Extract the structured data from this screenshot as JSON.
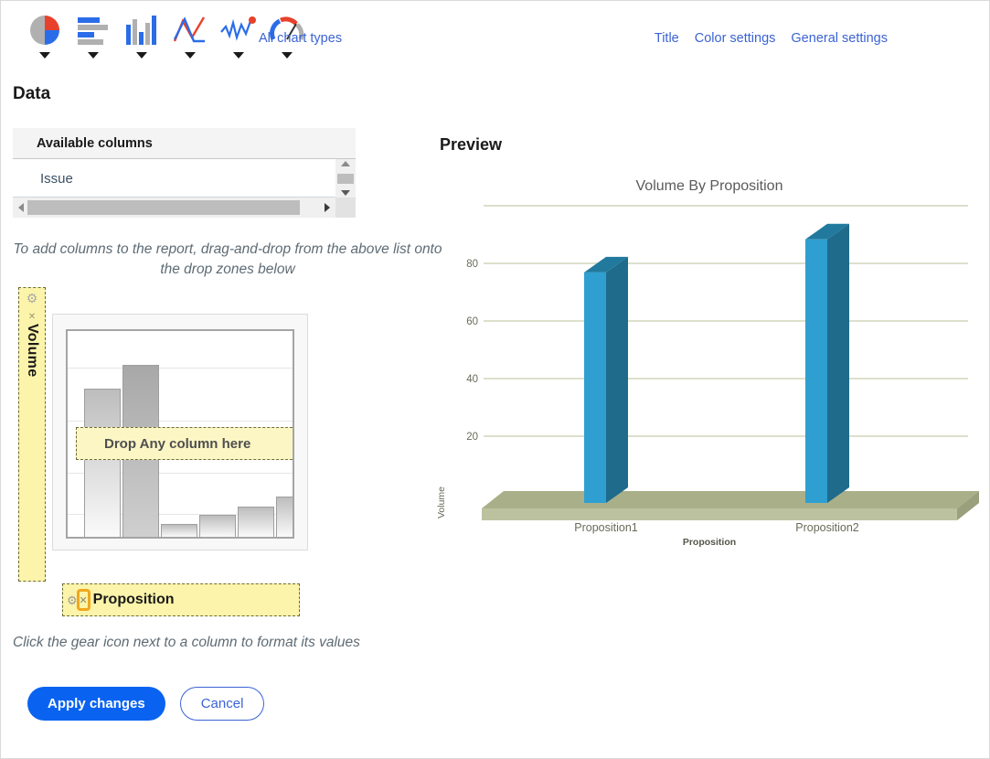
{
  "toolbar": {
    "chart_types": [
      {
        "name": "pie-chart-type",
        "label": "Pie"
      },
      {
        "name": "bar-chart-type",
        "label": "Bar"
      },
      {
        "name": "column-chart-type",
        "label": "Column"
      },
      {
        "name": "line-chart-type",
        "label": "Line"
      },
      {
        "name": "spline-chart-type",
        "label": "Spline"
      },
      {
        "name": "gauge-chart-type",
        "label": "Gauge"
      }
    ],
    "all_chart_types": "All chart types",
    "links": [
      {
        "label": "Title"
      },
      {
        "label": "Color settings"
      },
      {
        "label": "General settings"
      }
    ]
  },
  "data_section": {
    "title": "Data",
    "available_columns_header": "Available columns",
    "columns": [
      {
        "label": "Issue"
      }
    ],
    "hint_drag": "To add columns to the report, drag-and-drop from the above list onto the drop zones below",
    "hint_gear": "Click the gear icon next to a column to format its values",
    "value_zone": {
      "label": "Volume",
      "gear_icon": "gear-icon",
      "remove_icon": "close-icon"
    },
    "series_zone": {
      "label": "Drop Any column here"
    },
    "category_zone": {
      "label": "Proposition",
      "gear_icon": "gear-icon",
      "remove_icon": "close-icon"
    },
    "buttons": {
      "apply": "Apply changes",
      "cancel": "Cancel"
    }
  },
  "preview": {
    "title": "Preview"
  },
  "chart_data": {
    "type": "bar",
    "title": "Volume By Proposition",
    "categories": [
      "Proposition1",
      "Proposition2"
    ],
    "values": [
      77,
      88
    ],
    "series": [
      {
        "name": "Volume",
        "values": [
          77,
          88
        ]
      }
    ],
    "xlabel": "Proposition",
    "ylabel": "Volume",
    "ylim": [
      0,
      90
    ],
    "yticks": [
      20,
      40,
      60,
      80
    ],
    "ytick_labels": [
      "20",
      "40",
      "60",
      "80"
    ],
    "grid": true,
    "legend": "none",
    "colors": {
      "bar_front": "#2e9fd0",
      "bar_top": "#217a9e",
      "bar_side": "#1f6b8c",
      "floor": "#a9b089",
      "gridline": "#c8cdae",
      "title_text": "#5a5a5a"
    }
  },
  "theme": {
    "accent_blue": "#0a63f0",
    "link_blue": "#3b63d4",
    "dropzone_yellow": "#fcf4aa",
    "focus_orange": "#f0a81e"
  }
}
